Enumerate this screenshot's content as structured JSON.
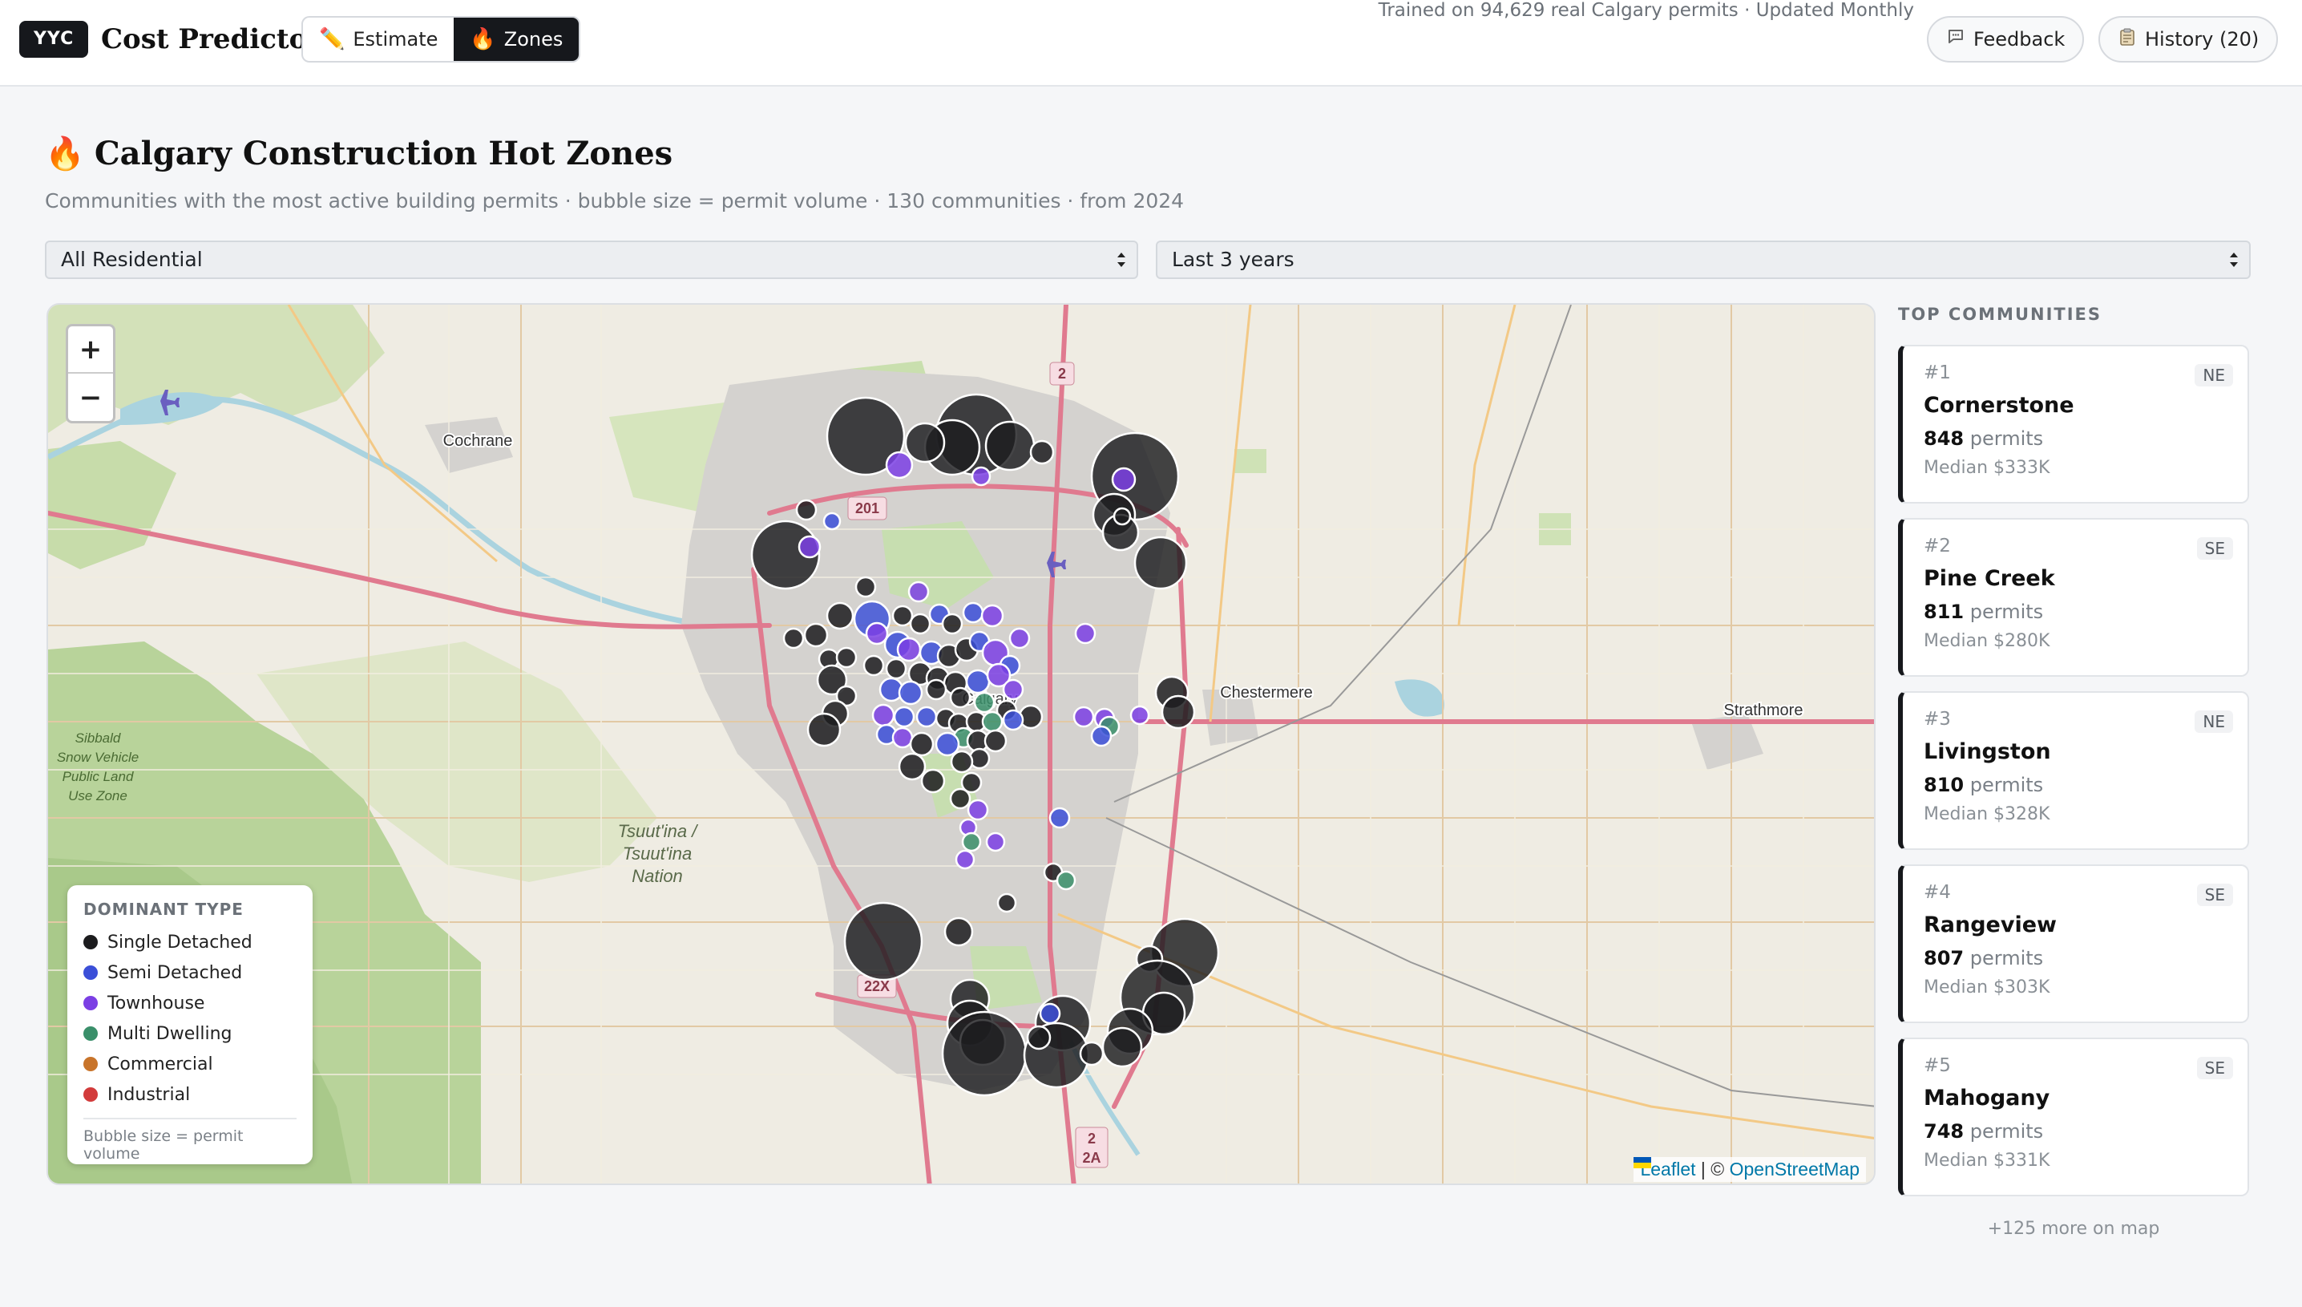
{
  "header": {
    "brand_badge": "YYC",
    "brand_title": "Cost Predictor",
    "tabs": [
      {
        "label": "Estimate",
        "icon": "pencil-icon",
        "glyph": "✏️"
      },
      {
        "label": "Zones",
        "icon": "fire-icon",
        "glyph": "🔥"
      }
    ],
    "trained_text": "Trained on 94,629 real Calgary permits · Updated Monthly",
    "feedback_label": "Feedback",
    "history_label": "History (20)"
  },
  "page": {
    "title_icon": "🔥",
    "title": "Calgary Construction Hot Zones",
    "subtitle": "Communities with the most active building permits · bubble size = permit volume · 130 communities · from 2024"
  },
  "filters": {
    "type_value": "All Residential",
    "period_value": "Last 3 years"
  },
  "map": {
    "zoom_in": "+",
    "zoom_out": "−",
    "attribution_leaflet": "Leaflet",
    "attribution_sep": " | © ",
    "attribution_osm": "OpenStreetMap",
    "labels": {
      "cochrane": "Cochrane",
      "chestermere": "Chestermere",
      "strathmore": "Strathmore",
      "sibbald": "Sibbald Snow Vehicle Public Land Use Zone",
      "tsuutina": "Tsuut'ina / Tsuut'ina Nation",
      "calgary": "Calgary",
      "hwy_201": "201",
      "hwy_2": "2",
      "hwy_22x": "22X",
      "hwy_2a": "2A"
    },
    "legend": {
      "title": "DOMINANT TYPE",
      "items": [
        {
          "label": "Single Detached",
          "color": "#1c1c1e"
        },
        {
          "label": "Semi Detached",
          "color": "#3b4fd8"
        },
        {
          "label": "Townhouse",
          "color": "#7b3fe4"
        },
        {
          "label": "Multi Dwelling",
          "color": "#3a8f6a"
        },
        {
          "label": "Commercial",
          "color": "#c8742a"
        },
        {
          "label": "Industrial",
          "color": "#d23b3b"
        }
      ],
      "note": "Bubble size = permit volume"
    }
  },
  "sidebar": {
    "title": "TOP COMMUNITIES",
    "cards": [
      {
        "rank": "#1",
        "region": "NE",
        "name": "Cornerstone",
        "permits": "848",
        "permits_unit": "permits",
        "median": "Median $333K"
      },
      {
        "rank": "#2",
        "region": "SE",
        "name": "Pine Creek",
        "permits": "811",
        "permits_unit": "permits",
        "median": "Median $280K"
      },
      {
        "rank": "#3",
        "region": "NE",
        "name": "Livingston",
        "permits": "810",
        "permits_unit": "permits",
        "median": "Median $328K"
      },
      {
        "rank": "#4",
        "region": "SE",
        "name": "Rangeview",
        "permits": "807",
        "permits_unit": "permits",
        "median": "Median $303K"
      },
      {
        "rank": "#5",
        "region": "SE",
        "name": "Mahogany",
        "permits": "748",
        "permits_unit": "permits",
        "median": "Median $331K"
      }
    ],
    "more_text": "+125 more on map"
  }
}
